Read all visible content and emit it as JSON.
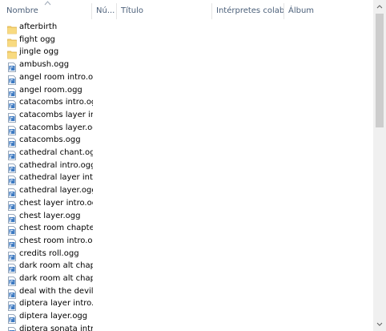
{
  "columns": {
    "name": "Nombre",
    "number": "Nú...",
    "title": "Título",
    "artists": "Intérpretes colabo...",
    "album": "Álbum"
  },
  "files": [
    {
      "label": "afterbirth",
      "type": "folder"
    },
    {
      "label": "fight ogg",
      "type": "folder"
    },
    {
      "label": "jingle ogg",
      "type": "folder"
    },
    {
      "label": "ambush.ogg",
      "type": "audio"
    },
    {
      "label": "angel room intro.ogg",
      "type": "audio"
    },
    {
      "label": "angel room.ogg",
      "type": "audio"
    },
    {
      "label": "catacombs intro.ogg",
      "type": "audio"
    },
    {
      "label": "catacombs layer int...",
      "type": "audio"
    },
    {
      "label": "catacombs layer.ogg",
      "type": "audio"
    },
    {
      "label": "catacombs.ogg",
      "type": "audio"
    },
    {
      "label": "cathedral chant.ogg",
      "type": "audio"
    },
    {
      "label": "cathedral intro.ogg",
      "type": "audio"
    },
    {
      "label": "cathedral layer intro...",
      "type": "audio"
    },
    {
      "label": "cathedral layer.ogg",
      "type": "audio"
    },
    {
      "label": "chest layer intro.ogg",
      "type": "audio"
    },
    {
      "label": "chest layer.ogg",
      "type": "audio"
    },
    {
      "label": "chest room chapter...",
      "type": "audio"
    },
    {
      "label": "chest room intro.ogg",
      "type": "audio"
    },
    {
      "label": "credits roll.ogg",
      "type": "audio"
    },
    {
      "label": "dark room alt chapt...",
      "type": "audio"
    },
    {
      "label": "dark room alt chapt...",
      "type": "audio"
    },
    {
      "label": "deal with the devil....",
      "type": "audio"
    },
    {
      "label": "diptera layer intro.o...",
      "type": "audio"
    },
    {
      "label": "diptera layer.ogg",
      "type": "audio"
    },
    {
      "label": "diptera sonata intro...",
      "type": "audio"
    }
  ],
  "icons": {
    "folder": "folder-icon",
    "audio": "audio-file-icon",
    "scroll_up": "chevron-up-icon",
    "scroll_down": "chevron-down-icon",
    "sort": "sort-ascending-icon"
  },
  "colors": {
    "header_text": "#4c607a",
    "folder": "#f3cf6b",
    "scrollbar_track": "#f0f0f0",
    "scrollbar_thumb": "#cdcdcd"
  }
}
